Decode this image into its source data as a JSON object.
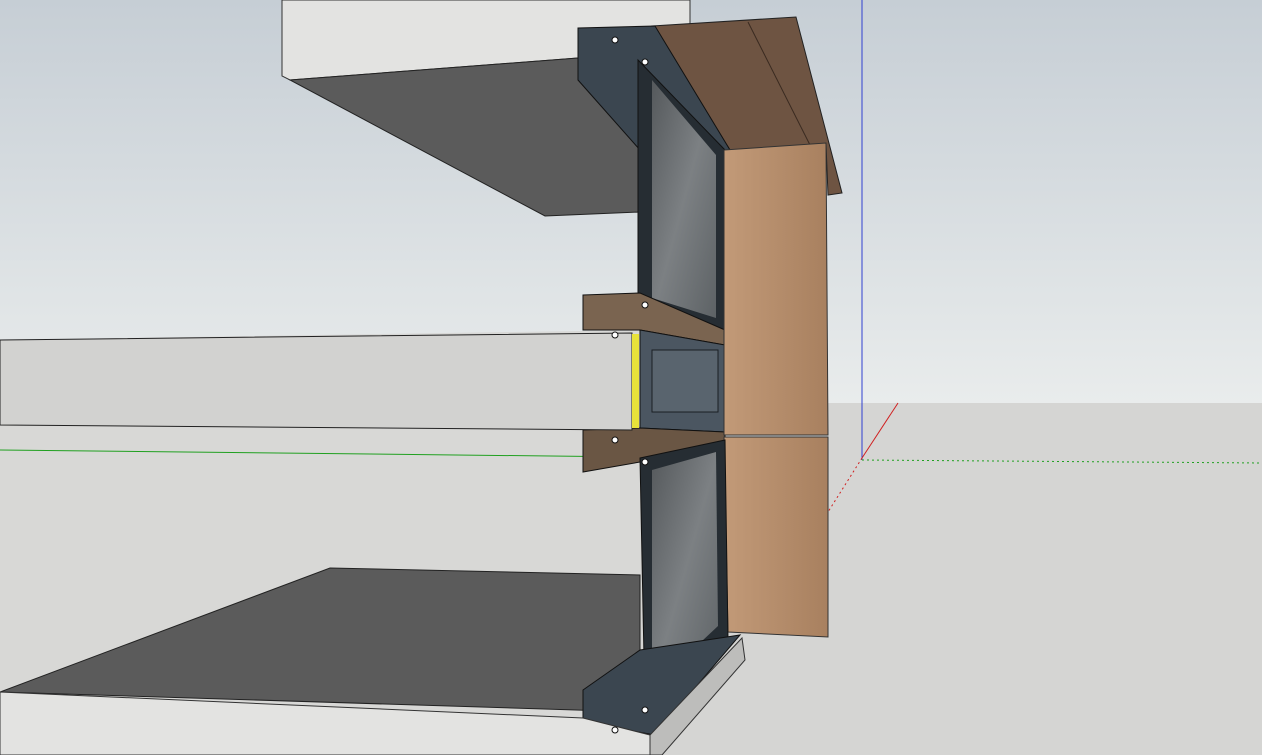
{
  "viewport": {
    "colors": {
      "sky_top": "#c9d0d6",
      "sky_bottom": "#e8ebec",
      "ground": "#d5d5d3",
      "concrete": "#e4e4e2",
      "slab_underside": "#5c5c5c",
      "wood_cap": "#6e5442",
      "wood_panel": "#b98f6d",
      "frame": "#283036",
      "glass": "#6c7174",
      "spandrel": "#4b5661",
      "insulation": "#e8e23a",
      "axis_red": "#d02020",
      "axis_green": "#20a020",
      "axis_blue": "#2030d0"
    }
  }
}
